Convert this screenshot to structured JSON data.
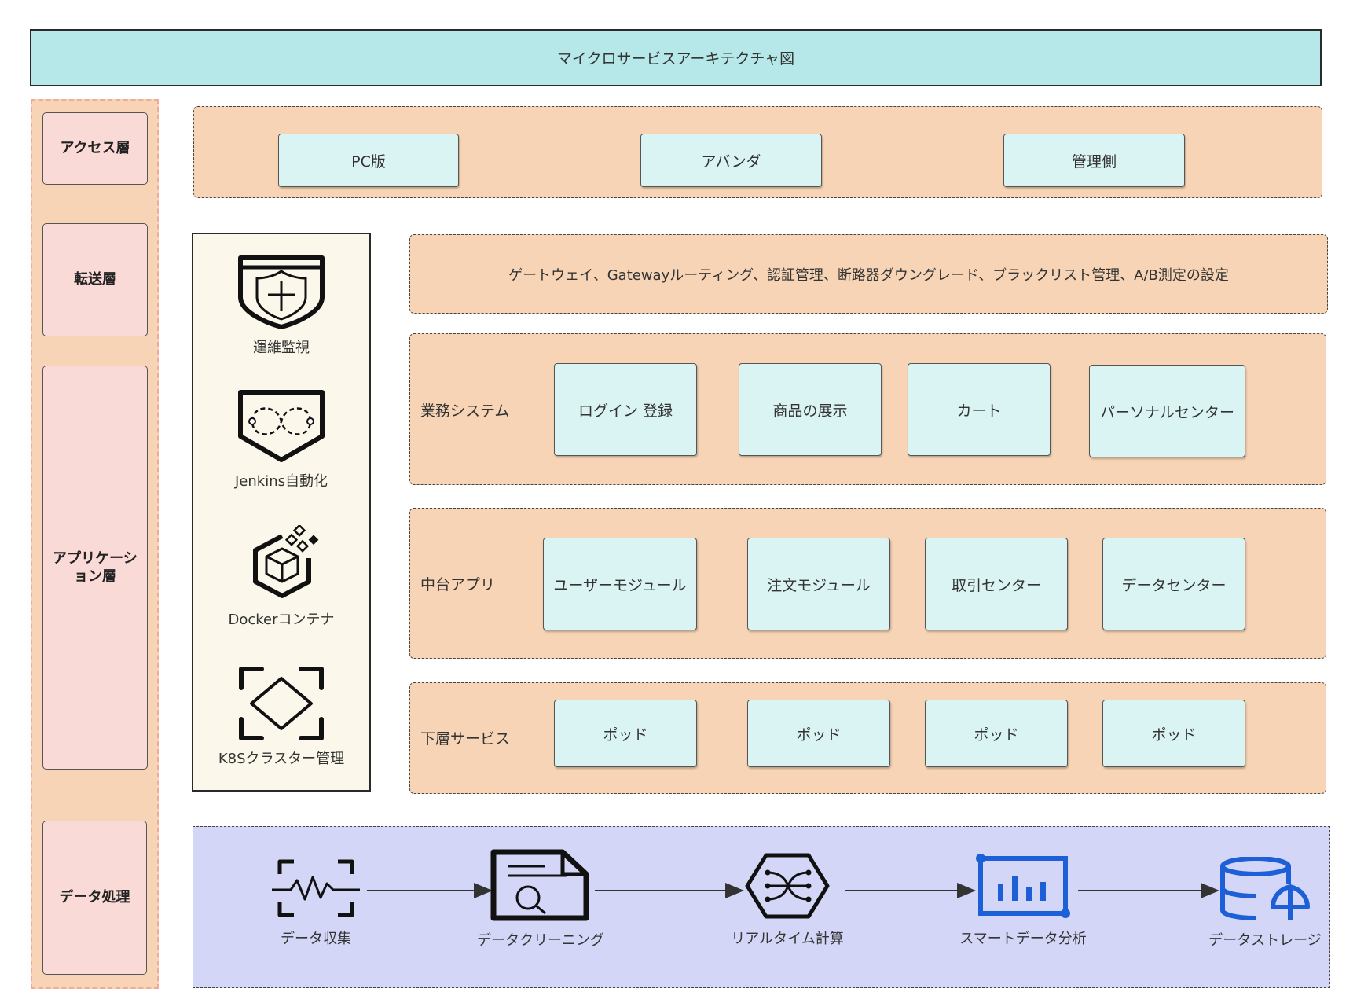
{
  "title": "マイクロサービスアーキテクチャ図",
  "layers": {
    "access": "アクセス層",
    "transfer": "転送層",
    "application": "アプリケーション層",
    "data": "データ処理"
  },
  "access_clients": [
    "PC版",
    "アバンダ",
    "管理側"
  ],
  "gateway_text": "ゲートウェイ、Gatewayルーティング、認証管理、断路器ダウングレード、ブラックリスト管理、A/B測定の設定",
  "ops": [
    {
      "label": "運維監視",
      "icon": "shield-plus-icon"
    },
    {
      "label": "Jenkins自動化",
      "icon": "infinity-shield-icon"
    },
    {
      "label": "Dockerコンテナ",
      "icon": "container-box-icon"
    },
    {
      "label": "K8Sクラスター管理",
      "icon": "diamond-frame-icon"
    }
  ],
  "business": {
    "label": "業務システム",
    "items": [
      "ログイン 登録",
      "商品の展示",
      "カート",
      "パーソナルセンター"
    ]
  },
  "middle": {
    "label": "中台アプリ",
    "items": [
      "ユーザーモジュール",
      "注文モジュール",
      "取引センター",
      "データセンター"
    ]
  },
  "lower": {
    "label": "下層サービス",
    "items": [
      "ポッド",
      "ポッド",
      "ポッド",
      "ポッド"
    ]
  },
  "data_flow": [
    {
      "label": "データ収集",
      "icon": "pulse-scan-icon"
    },
    {
      "label": "データクリーニング",
      "icon": "document-search-icon"
    },
    {
      "label": "リアルタイム計算",
      "icon": "hexagon-flow-icon"
    },
    {
      "label": "スマートデータ分析",
      "icon": "bar-chart-icon"
    },
    {
      "label": "データストレージ",
      "icon": "database-icon"
    }
  ],
  "colors": {
    "title_bg": "#b6e8e9",
    "panel_bg": "#f6d4b5",
    "box_bg": "#daf3f3",
    "layer_bg": "#f9dad7",
    "ops_bg": "#fbf8eb",
    "data_bg": "#d3d6f7",
    "accent_blue": "#1c5fd6"
  }
}
